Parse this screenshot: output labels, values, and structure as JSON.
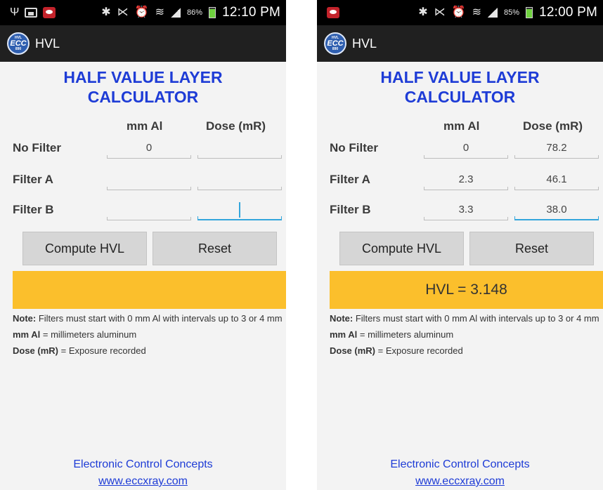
{
  "screens": [
    {
      "status": {
        "battery_pct": "86%",
        "battery_level": 0.86,
        "charging": true,
        "time": "12:10 PM"
      },
      "app_title": "HVL",
      "logo": {
        "top": "HVL",
        "main": "ECC",
        "bottom": "890"
      },
      "calc_title": [
        "HALF VALUE LAYER",
        "CALCULATOR"
      ],
      "columns": {
        "mm": "mm Al",
        "dose": "Dose (mR)"
      },
      "rows": [
        {
          "label": "No Filter",
          "mm": "0",
          "dose": ""
        },
        {
          "label": "Filter A",
          "mm": "",
          "dose": ""
        },
        {
          "label": "Filter B",
          "mm": "",
          "dose": ""
        }
      ],
      "buttons": {
        "compute": "Compute HVL",
        "reset": "Reset"
      },
      "result": "",
      "notes": {
        "note_label": "Note:",
        "note_text": " Filters must start with 0 mm Al with intervals up to 3 or 4 mm",
        "mm_label": "mm Al",
        "mm_text": " = millimeters aluminum",
        "dose_label": "Dose (mR)",
        "dose_text": " = Exposure recorded"
      },
      "footer": {
        "company": "Electronic Control Concepts",
        "url": "www.eccxray.com"
      }
    },
    {
      "status": {
        "battery_pct": "85%",
        "battery_level": 0.85,
        "charging": false,
        "time": "12:00 PM"
      },
      "app_title": "HVL",
      "logo": {
        "top": "HVL",
        "main": "ECC",
        "bottom": "890"
      },
      "calc_title": [
        "HALF VALUE LAYER",
        "CALCULATOR"
      ],
      "columns": {
        "mm": "mm Al",
        "dose": "Dose (mR)"
      },
      "rows": [
        {
          "label": "No Filter",
          "mm": "0",
          "dose": "78.2"
        },
        {
          "label": "Filter A",
          "mm": "2.3",
          "dose": "46.1"
        },
        {
          "label": "Filter B",
          "mm": "3.3",
          "dose": "38.0"
        }
      ],
      "buttons": {
        "compute": "Compute HVL",
        "reset": "Reset"
      },
      "result": "HVL = 3.148",
      "notes": {
        "note_label": "Note:",
        "note_text": " Filters must start with 0 mm Al with intervals up to 3 or 4 mm",
        "mm_label": "mm Al",
        "mm_text": " = millimeters aluminum",
        "dose_label": "Dose (mR)",
        "dose_text": " = Exposure recorded"
      },
      "footer": {
        "company": "Electronic Control Concepts",
        "url": "www.eccxray.com"
      }
    }
  ],
  "colors": {
    "title_blue": "#1e3cd6",
    "result_bg": "#fbbf2c",
    "focus_blue": "#33a6dc",
    "battery_green": "#6fd13f"
  },
  "icons": [
    "usb-icon",
    "gallery-icon",
    "app-notify-icon",
    "bluetooth-icon",
    "mute-icon",
    "alarm-icon",
    "wifi-icon",
    "signal-icon",
    "battery-icon"
  ]
}
